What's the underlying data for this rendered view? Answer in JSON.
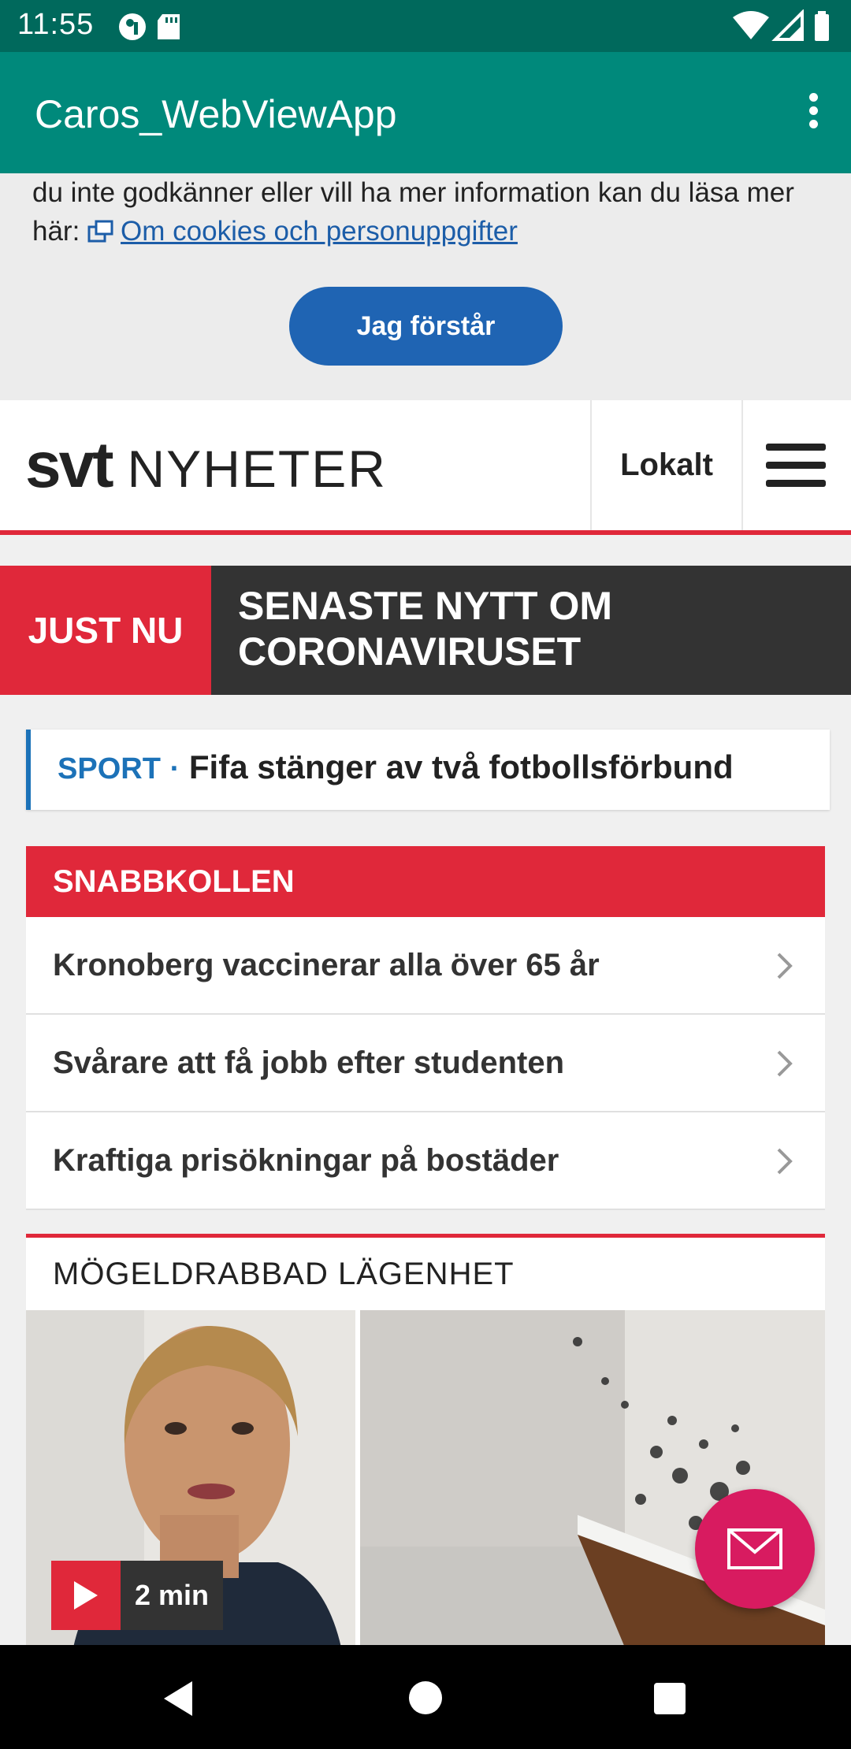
{
  "status_bar": {
    "time": "11:55",
    "left_icons": [
      "vpn-key-icon",
      "sd-card-icon"
    ],
    "right_icons": [
      "wifi-icon",
      "signal-icon",
      "battery-icon"
    ]
  },
  "app_bar": {
    "title": "Caros_WebViewApp",
    "menu_icon": "more-vert-icon"
  },
  "cookie_banner": {
    "text": "du inte godkänner eller vill ha mer information kan du läsa mer här:",
    "link_text": "Om cookies och personuppgifter",
    "button_label": "Jag förstår"
  },
  "header": {
    "logo_brand": "svt",
    "logo_section": "NYHETER",
    "lokalt_label": "Lokalt",
    "menu_icon": "hamburger-menu-icon",
    "accent_color": "#e0283a"
  },
  "just_nu": {
    "tag": "JUST NU",
    "title": "SENASTE NYTT OM CORONAVIRUSET"
  },
  "sport": {
    "kicker": "SPORT",
    "separator": "·",
    "headline": "Fifa stänger av två fotbollsförbund"
  },
  "snabbkollen": {
    "heading": "SNABBKOLLEN",
    "items": [
      {
        "label": "Kronoberg vaccinerar alla över 65 år"
      },
      {
        "label": "Svårare att få jobb efter studenten"
      },
      {
        "label": "Kraftiga prisökningar på bostäder"
      }
    ]
  },
  "story": {
    "title": "MÖGELDRABBAD LÄGENHET",
    "duration": "2 min"
  },
  "fab": {
    "icon": "mail-icon",
    "color": "#d81b60"
  },
  "nav_bar": {
    "icons": [
      "back-icon",
      "home-icon",
      "recents-icon"
    ]
  }
}
